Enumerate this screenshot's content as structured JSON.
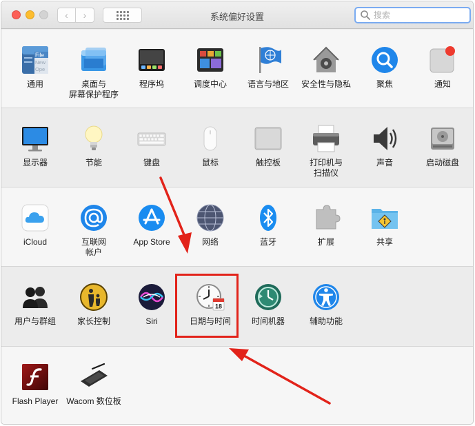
{
  "window": {
    "title": "系统偏好设置"
  },
  "toolbar": {
    "back_label": "‹",
    "forward_label": "›"
  },
  "search": {
    "placeholder": "搜索"
  },
  "rows": [
    {
      "items": [
        {
          "label": "通用",
          "icon": "general-icon"
        },
        {
          "label": "桌面与\n屏幕保护程序",
          "icon": "desktop-screensaver-icon"
        },
        {
          "label": "程序坞",
          "icon": "dock-icon"
        },
        {
          "label": "调度中心",
          "icon": "mission-control-icon"
        },
        {
          "label": "语言与地区",
          "icon": "language-region-icon"
        },
        {
          "label": "安全性与隐私",
          "icon": "security-privacy-icon"
        },
        {
          "label": "聚焦",
          "icon": "spotlight-icon"
        },
        {
          "label": "通知",
          "icon": "notifications-icon"
        }
      ]
    },
    {
      "items": [
        {
          "label": "显示器",
          "icon": "displays-icon"
        },
        {
          "label": "节能",
          "icon": "energy-saver-icon"
        },
        {
          "label": "键盘",
          "icon": "keyboard-icon"
        },
        {
          "label": "鼠标",
          "icon": "mouse-icon"
        },
        {
          "label": "触控板",
          "icon": "trackpad-icon"
        },
        {
          "label": "打印机与\n扫描仪",
          "icon": "printers-scanners-icon"
        },
        {
          "label": "声音",
          "icon": "sound-icon"
        },
        {
          "label": "启动磁盘",
          "icon": "startup-disk-icon"
        }
      ]
    },
    {
      "items": [
        {
          "label": "iCloud",
          "icon": "icloud-icon"
        },
        {
          "label": "互联网\n帐户",
          "icon": "internet-accounts-icon"
        },
        {
          "label": "App Store",
          "icon": "app-store-icon"
        },
        {
          "label": "网络",
          "icon": "network-icon"
        },
        {
          "label": "蓝牙",
          "icon": "bluetooth-icon"
        },
        {
          "label": "扩展",
          "icon": "extensions-icon"
        },
        {
          "label": "共享",
          "icon": "sharing-icon"
        }
      ]
    },
    {
      "items": [
        {
          "label": "用户与群组",
          "icon": "users-groups-icon"
        },
        {
          "label": "家长控制",
          "icon": "parental-controls-icon"
        },
        {
          "label": "Siri",
          "icon": "siri-icon"
        },
        {
          "label": "日期与时间",
          "icon": "date-time-icon"
        },
        {
          "label": "时间机器",
          "icon": "time-machine-icon"
        },
        {
          "label": "辅助功能",
          "icon": "accessibility-icon"
        }
      ]
    },
    {
      "items": [
        {
          "label": "Flash Player",
          "icon": "flash-player-icon"
        },
        {
          "label": "Wacom 数位板",
          "icon": "wacom-tablet-icon"
        }
      ]
    }
  ],
  "icon_text": {
    "general_file": "File",
    "general_new": "New",
    "general_ope": "Ope",
    "calendar_day": "18"
  },
  "colors": {
    "annotation_red": "#e2231a",
    "search_focus": "#7aabf1"
  }
}
